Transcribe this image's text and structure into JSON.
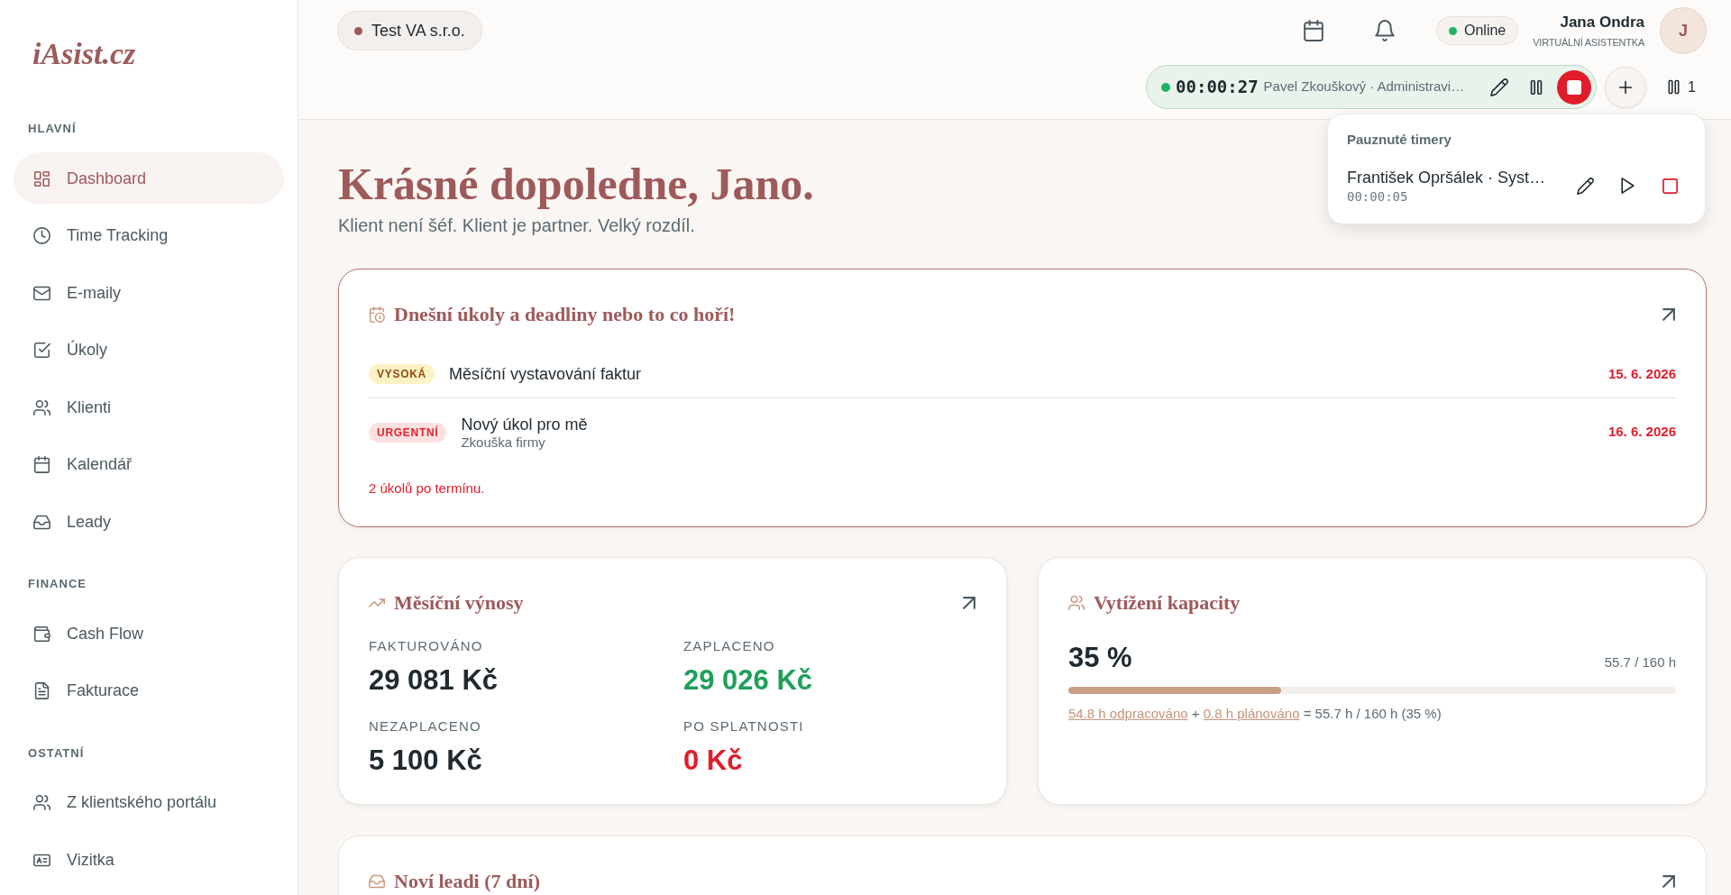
{
  "sidebar": {
    "logo": "iAsist.cz",
    "sections": [
      {
        "heading": "HLAVNÍ",
        "items": [
          {
            "label": "Dashboard",
            "selected": true
          },
          {
            "label": "Time Tracking",
            "selected": false
          },
          {
            "label": "E-maily",
            "selected": false
          },
          {
            "label": "Úkoly",
            "selected": false
          },
          {
            "label": "Klienti",
            "selected": false
          },
          {
            "label": "Kalendář",
            "selected": false
          },
          {
            "label": "Leady",
            "selected": false
          }
        ]
      },
      {
        "heading": "FINANCE",
        "items": [
          {
            "label": "Cash Flow",
            "selected": false
          },
          {
            "label": "Fakturace",
            "selected": false
          }
        ]
      },
      {
        "heading": "OSTATNÍ",
        "items": [
          {
            "label": "Z klientského portálu",
            "selected": false
          },
          {
            "label": "Vizitka",
            "selected": false
          }
        ]
      }
    ]
  },
  "header": {
    "workspace": "Test VA s.r.o.",
    "status": "Online",
    "user": {
      "name": "Jana Ondra",
      "role": "VIRTUÁLNÍ ASISTENTKA",
      "initial": "J"
    },
    "active_timer": {
      "time": "00:00:27",
      "description": "Pavel Zkouškový · Administravi…"
    },
    "paused_count": "1"
  },
  "paused_timers": {
    "title": "Pauznuté timery",
    "items": [
      {
        "label": "František Opršálek · Syst…",
        "time": "00:00:05"
      }
    ]
  },
  "greeting": {
    "title": "Krásné dopoledne, Jano.",
    "subtitle": "Klient není šéf. Klient je partner. Velký rozdíl."
  },
  "tasks_card": {
    "title": "Dnešní úkoly a deadliny nebo to co hoří!",
    "tasks": [
      {
        "priority": "VYSOKÁ",
        "kind": "high",
        "title": "Měsíční vystavování faktur",
        "date": "15. 6. 2026"
      },
      {
        "priority": "URGENTNÍ",
        "kind": "urgent",
        "title": "Nový úkol pro mě",
        "subtitle": "Zkouška firmy",
        "date": "16. 6. 2026"
      }
    ],
    "overdue": "2 úkolů po termínu."
  },
  "revenue_card": {
    "title": "Měsíční výnosy",
    "stats": [
      {
        "label": "FAKTUROVÁNO",
        "value": "29 081 Kč",
        "kind": "neutral"
      },
      {
        "label": "ZAPLACENO",
        "value": "29 026 Kč",
        "kind": "positive"
      },
      {
        "label": "NEZAPLACENO",
        "value": "5 100 Kč",
        "kind": "neutral"
      },
      {
        "label": "PO SPLATNOSTI",
        "value": "0 Kč",
        "kind": "negative"
      }
    ]
  },
  "capacity_card": {
    "title": "Vytížení kapacity",
    "percent": "35 %",
    "hours": "55.7 / 160 h",
    "level": 0.35,
    "breakdown": [
      {
        "kind": "link",
        "text": "54.8 h odpracováno"
      },
      {
        "kind": "text",
        "text": "+"
      },
      {
        "kind": "link",
        "text": "0.8 h plánováno"
      },
      {
        "kind": "text",
        "text": "= 55.7 h / 160 h (35 %)"
      }
    ]
  },
  "leads_card": {
    "title": "Noví leadi (7 dní)"
  }
}
